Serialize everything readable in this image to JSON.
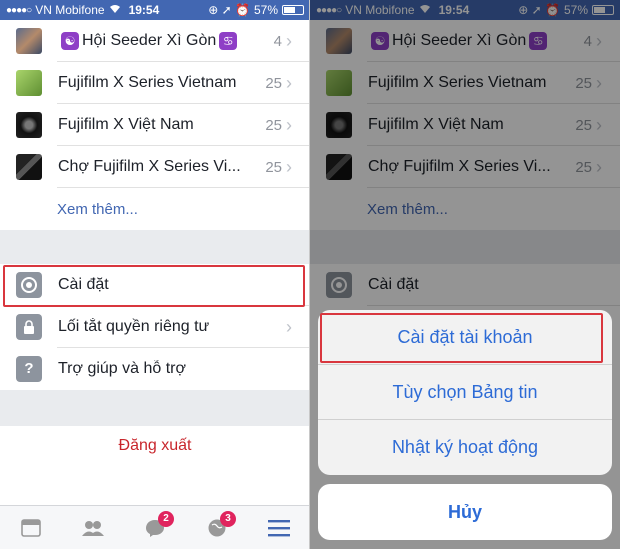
{
  "status_bar": {
    "signal": "●●●●○",
    "carrier": "VN Mobifone",
    "wifi_icon": "wifi-icon",
    "time": "19:54",
    "icons": "⊕ ➚ ⏰",
    "battery": "57%",
    "battery_level": 0.57
  },
  "groups": [
    {
      "name": "Hội Seeder Xì Gòn",
      "count": "4",
      "thumb": "t1"
    },
    {
      "name": "Fujifilm X Series Vietnam",
      "count": "25",
      "thumb": "t2"
    },
    {
      "name": "Fujifilm X Việt Nam",
      "count": "25",
      "thumb": "t3"
    },
    {
      "name": "Chợ Fujifilm X Series Vi...",
      "count": "25",
      "thumb": "t4"
    }
  ],
  "see_more": "Xem thêm...",
  "menu": {
    "settings": "Cài đặt",
    "privacy_shortcuts": "Lối tắt quyền riêng tư",
    "help": "Trợ giúp và hỗ trợ",
    "help_icon": "?",
    "logout": "Đăng xuất"
  },
  "tabbar": {
    "messages_badge": "2",
    "notifications_badge": "3"
  },
  "action_sheet": {
    "items": [
      "Cài đặt tài khoản",
      "Tùy chọn Bảng tin",
      "Nhật ký hoạt động"
    ],
    "cancel": "Hủy"
  },
  "colors": {
    "brand": "#4267b2",
    "highlight": "#d9363e",
    "logout": "#c8262c",
    "sheet_text": "#2d6bd6"
  }
}
